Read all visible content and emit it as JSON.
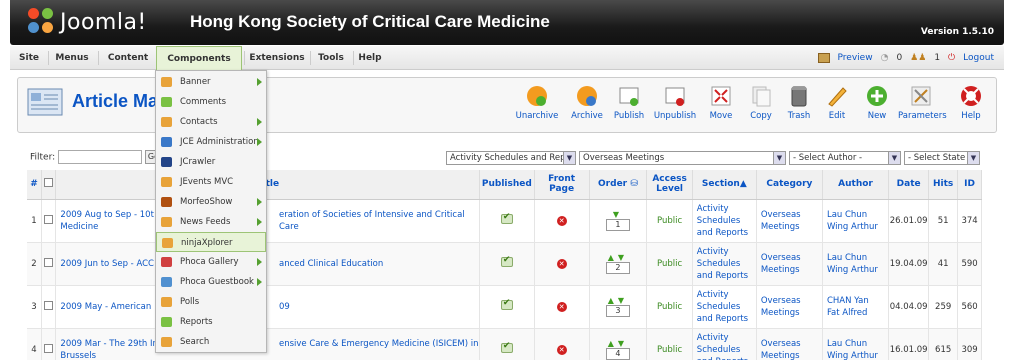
{
  "header": {
    "logo_text": "Joomla!",
    "site_title": "Hong Kong Society of Critical Care Medicine",
    "version": "Version 1.5.10"
  },
  "menu": {
    "items": [
      "Site",
      "Menus",
      "Content",
      "Components",
      "Extensions",
      "Tools",
      "Help"
    ],
    "active": "Components"
  },
  "status": {
    "preview": "Preview",
    "messages": "0",
    "users": "1",
    "logout": "Logout"
  },
  "toolbar": {
    "title": "Article Manager",
    "buttons": [
      "Unarchive",
      "Archive",
      "Publish",
      "Unpublish",
      "Move",
      "Copy",
      "Trash",
      "Edit",
      "New",
      "Parameters",
      "Help"
    ]
  },
  "filter": {
    "label": "Filter:",
    "go": "Go",
    "section_select": "Activity Schedules and Reports",
    "category_select": "Overseas Meetings",
    "author_select": "- Select Author -",
    "state_select": "- Select State -"
  },
  "dropdown": {
    "items": [
      {
        "label": "Banner",
        "sub": true
      },
      {
        "label": "Comments",
        "sub": false
      },
      {
        "label": "Contacts",
        "sub": true
      },
      {
        "label": "JCE Administration",
        "sub": true
      },
      {
        "label": "JCrawler",
        "sub": false
      },
      {
        "label": "JEvents MVC",
        "sub": false
      },
      {
        "label": "MorfeoShow",
        "sub": true
      },
      {
        "label": "News Feeds",
        "sub": true
      },
      {
        "label": "ninjaXplorer",
        "sub": false
      },
      {
        "label": "Phoca Gallery",
        "sub": true
      },
      {
        "label": "Phoca Guestbook",
        "sub": true
      },
      {
        "label": "Polls",
        "sub": false
      },
      {
        "label": "Reports",
        "sub": false
      },
      {
        "label": "Search",
        "sub": false
      }
    ]
  },
  "table": {
    "columns": [
      "#",
      "",
      "Title",
      "Published",
      "Front Page",
      "Order",
      "Access Level",
      "Section",
      "Category",
      "Author",
      "Date",
      "Hits",
      "ID"
    ],
    "rows": [
      {
        "num": "1",
        "title_left": "2009 Aug to Sep - 10t",
        "title_left2": "Medicine",
        "title_right": "eration of Societies of Intensive and Critical Care",
        "order": "1",
        "access": "Public",
        "section": [
          "Activity",
          "Schedules",
          "and Reports"
        ],
        "category": [
          "Overseas",
          "Meetings"
        ],
        "author": [
          "Lau Chun",
          "Wing Arthur"
        ],
        "date": "26.01.09",
        "hits": "51",
        "id": "374"
      },
      {
        "num": "2",
        "title_left": "2009 Jun to Sep - ACC",
        "title_left2": "",
        "title_right": "anced Clinical Education",
        "order": "2",
        "access": "Public",
        "section": [
          "Activity",
          "Schedules",
          "and Reports"
        ],
        "category": [
          "Overseas",
          "Meetings"
        ],
        "author": [
          "Lau Chun",
          "Wing Arthur"
        ],
        "date": "19.04.09",
        "hits": "41",
        "id": "590"
      },
      {
        "num": "3",
        "title_left": "2009 May - American",
        "title_left2": "",
        "title_right": "09",
        "order": "3",
        "access": "Public",
        "section": [
          "Activity",
          "Schedules",
          "and Reports"
        ],
        "category": [
          "Overseas",
          "Meetings"
        ],
        "author": [
          "CHAN Yan",
          "Fat Alfred"
        ],
        "date": "04.04.09",
        "hits": "259",
        "id": "560"
      },
      {
        "num": "4",
        "title_left": "2009 Mar - The 29th In",
        "title_left2": "Brussels",
        "title_right": "ensive Care & Emergency Medicine (ISICEM) in",
        "order": "4",
        "access": "Public",
        "section": [
          "Activity",
          "Schedules",
          "and Reports"
        ],
        "category": [
          "Overseas",
          "Meetings"
        ],
        "author": [
          "Lau Chun",
          "Wing Arthur"
        ],
        "date": "16.01.09",
        "hits": "615",
        "id": "309"
      }
    ]
  }
}
